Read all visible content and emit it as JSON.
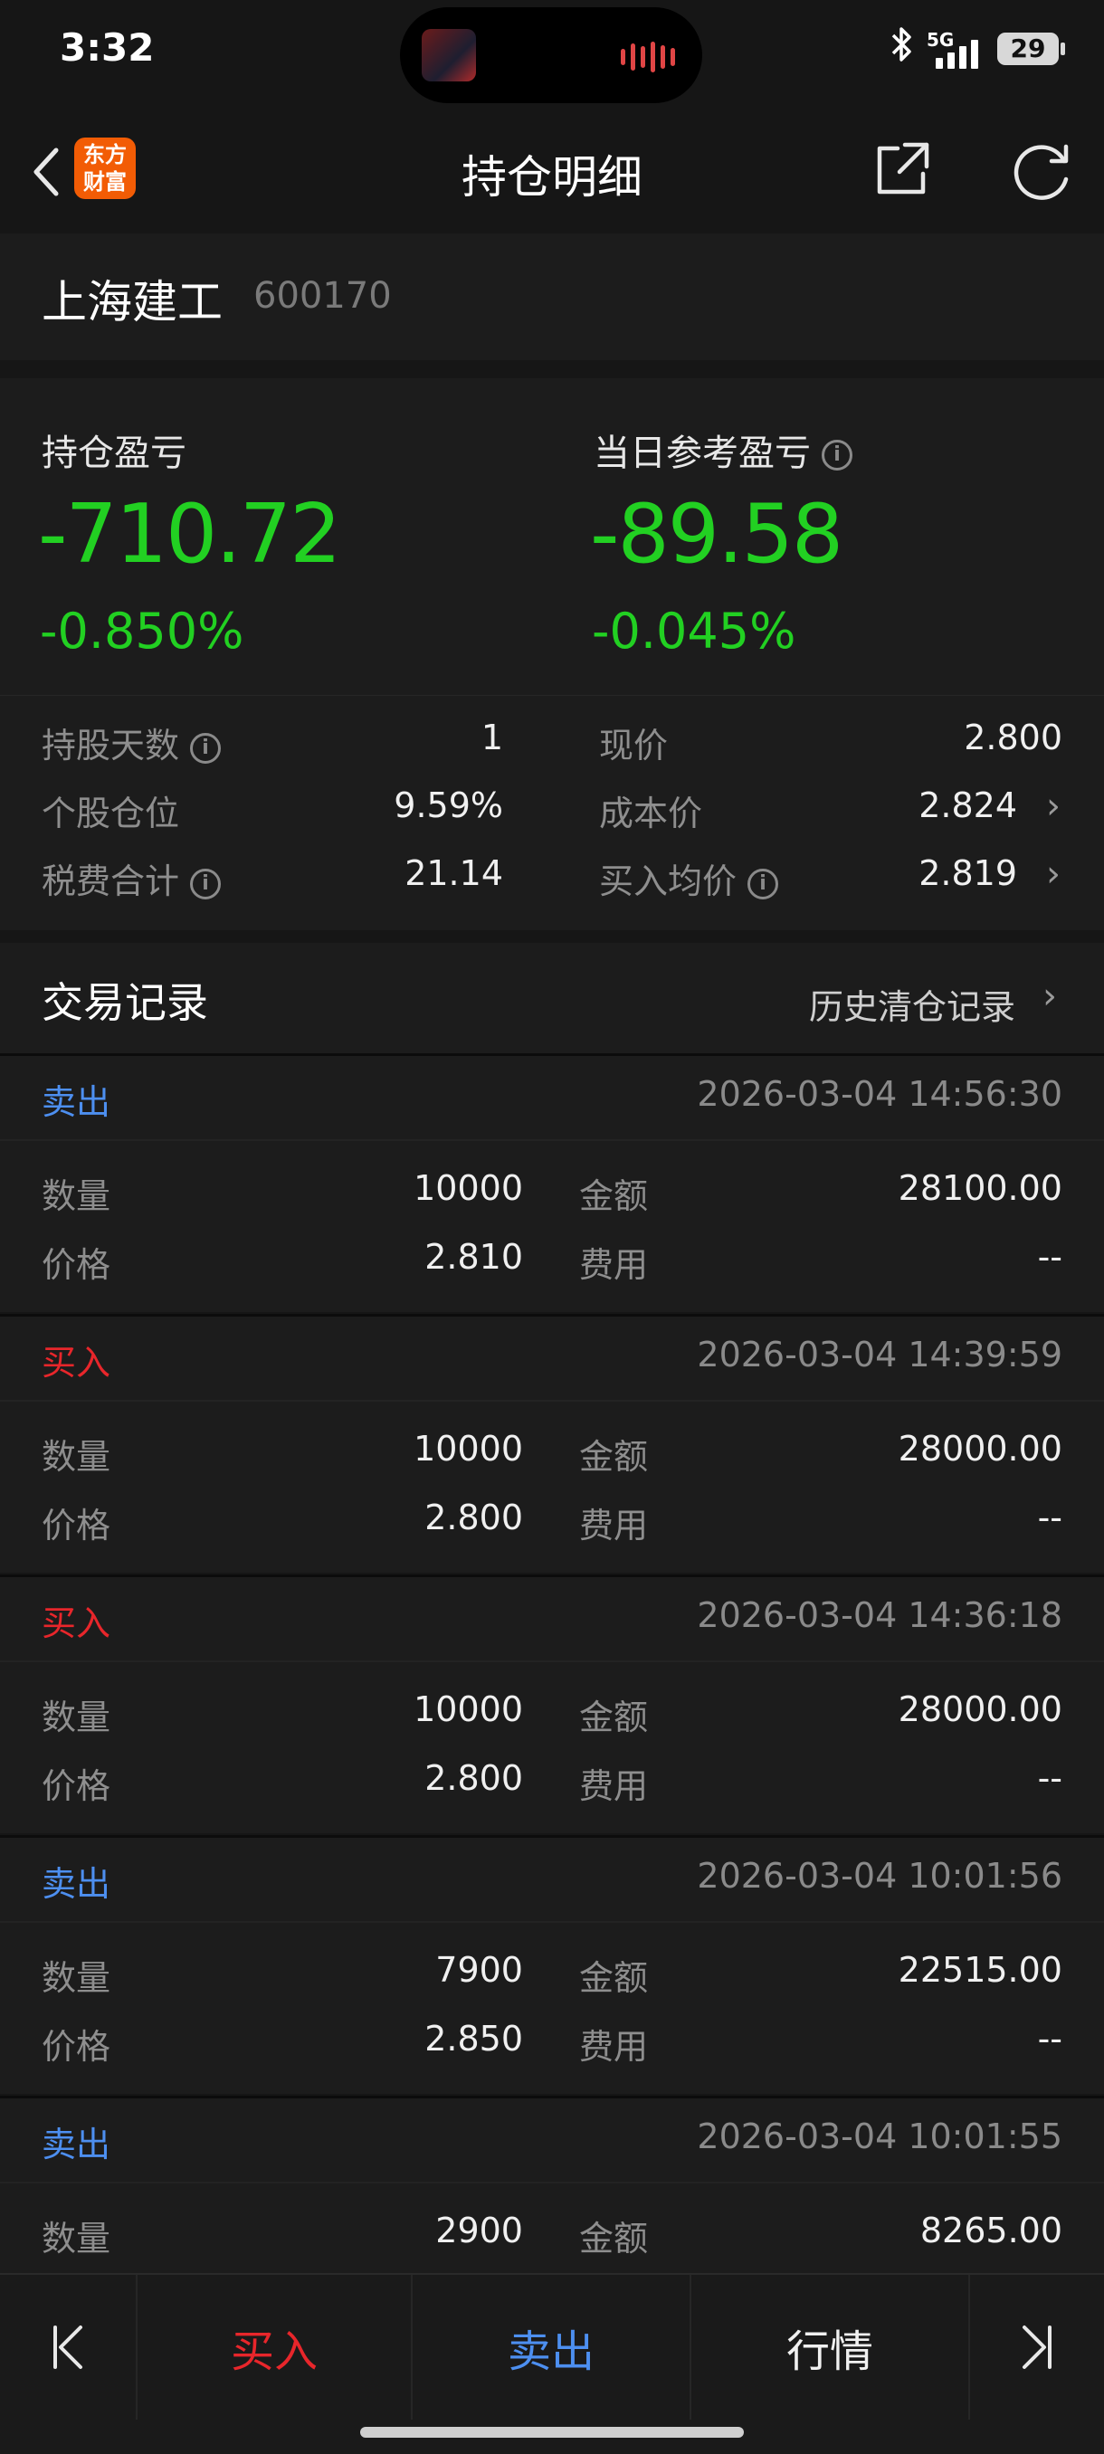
{
  "status": {
    "time": "3:32",
    "network": "5G",
    "battery": "29"
  },
  "header": {
    "logo_text_1": "东方",
    "logo_text_2": "财富",
    "title": "持仓明细"
  },
  "stock": {
    "name": "上海建工",
    "code": "600170"
  },
  "pnl": {
    "holding_label": "持仓盈亏",
    "holding_value": "-710.72",
    "holding_pct": "-0.850%",
    "daily_label": "当日参考盈亏",
    "daily_value": "-89.58",
    "daily_pct": "-0.045%"
  },
  "stats": {
    "days_label": "持股天数",
    "days_value": "1",
    "price_label": "现价",
    "price_value": "2.800",
    "position_label": "个股仓位",
    "position_value": "9.59%",
    "cost_label": "成本价",
    "cost_value": "2.824",
    "fee_label": "税费合计",
    "fee_value": "21.14",
    "avg_label": "买入均价",
    "avg_value": "2.819"
  },
  "trades_header": {
    "title": "交易记录",
    "history_link": "历史清仓记录"
  },
  "labels": {
    "qty": "数量",
    "amount": "金额",
    "price": "价格",
    "fee": "费用"
  },
  "trades": [
    {
      "type": "卖出",
      "time": "2026-03-04 14:56:30",
      "qty": "10000",
      "amount": "28100.00",
      "price": "2.810",
      "fee": "--"
    },
    {
      "type": "买入",
      "time": "2026-03-04 14:39:59",
      "qty": "10000",
      "amount": "28000.00",
      "price": "2.800",
      "fee": "--"
    },
    {
      "type": "买入",
      "time": "2026-03-04 14:36:18",
      "qty": "10000",
      "amount": "28000.00",
      "price": "2.800",
      "fee": "--"
    },
    {
      "type": "卖出",
      "time": "2026-03-04 10:01:56",
      "qty": "7900",
      "amount": "22515.00",
      "price": "2.850",
      "fee": "--"
    },
    {
      "type": "卖出",
      "time": "2026-03-04 10:01:55",
      "qty": "2900",
      "amount": "8265.00"
    }
  ],
  "bottom": {
    "buy": "买入",
    "sell": "卖出",
    "quote": "行情"
  },
  "colors": {
    "loss_green": "#22d022",
    "sell_blue": "#4d8ff0",
    "buy_red": "#e8262b",
    "background": "#161616"
  }
}
